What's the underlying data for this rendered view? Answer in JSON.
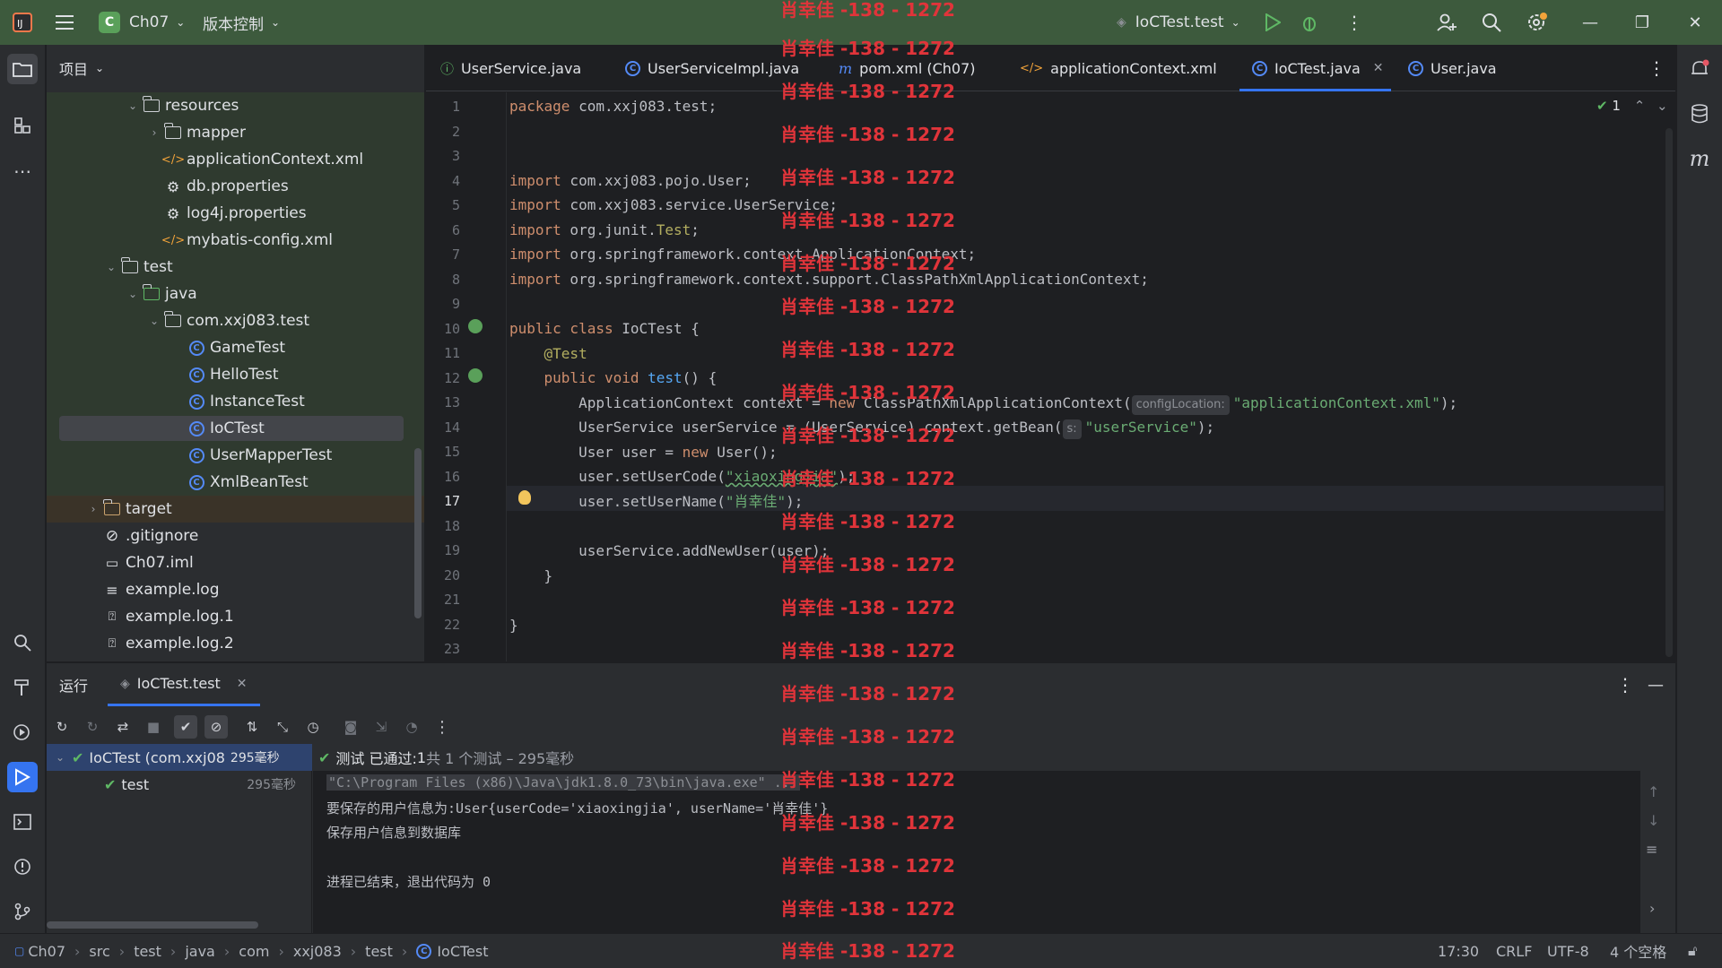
{
  "titlebar": {
    "project_badge": "C",
    "project_name": "Ch07",
    "vcs_label": "版本控制",
    "run_config": "IoCTest.test"
  },
  "project_panel": {
    "title": "项目",
    "items": [
      {
        "label": "resources"
      },
      {
        "label": "mapper"
      },
      {
        "label": "applicationContext.xml"
      },
      {
        "label": "db.properties"
      },
      {
        "label": "log4j.properties"
      },
      {
        "label": "mybatis-config.xml"
      },
      {
        "label": "test"
      },
      {
        "label": "java"
      },
      {
        "label": "com.xxj083.test"
      },
      {
        "label": "GameTest"
      },
      {
        "label": "HelloTest"
      },
      {
        "label": "InstanceTest"
      },
      {
        "label": "IoCTest"
      },
      {
        "label": "UserMapperTest"
      },
      {
        "label": "XmlBeanTest"
      },
      {
        "label": "target"
      },
      {
        "label": ".gitignore"
      },
      {
        "label": "Ch07.iml"
      },
      {
        "label": "example.log"
      },
      {
        "label": "example.log.1"
      },
      {
        "label": "example.log.2"
      }
    ]
  },
  "tabs": [
    {
      "label": "UserService.java"
    },
    {
      "label": "UserServiceImpl.java"
    },
    {
      "label": "pom.xml (Ch07)"
    },
    {
      "label": "applicationContext.xml"
    },
    {
      "label": "IoCTest.java"
    },
    {
      "label": "User.java"
    }
  ],
  "editor": {
    "inspection_count": "1",
    "line_numbers": [
      "1",
      "2",
      "3",
      "4",
      "5",
      "6",
      "7",
      "8",
      "9",
      "10",
      "11",
      "12",
      "13",
      "14",
      "15",
      "16",
      "17",
      "18",
      "19",
      "20",
      "21",
      "22",
      "23"
    ],
    "current_line": 17,
    "code": {
      "l1_kw": "package",
      "l1_rest": " com.xxj083.test;",
      "l4_kw": "import",
      "l4_rest": " com.xxj083.pojo.User;",
      "l5_kw": "import",
      "l5_rest": " com.xxj083.service.UserService;",
      "l6_kw": "import",
      "l6_a": " org.junit.",
      "l6_b": "Test",
      "l6_c": ";",
      "l7_kw": "import",
      "l7_rest": " org.springframework.context.ApplicationContext;",
      "l8_kw": "import",
      "l8_rest": " org.springframework.context.support.ClassPathXmlApplicationContext;",
      "l10_kw": "public class",
      "l10_rest": " IoCTest {",
      "l11_ann": "@Test",
      "l12_kw": "public void",
      "l12_fn": "test",
      "l12_rest": "() {",
      "l13_a": "ApplicationContext context = ",
      "l13_kw": "new",
      "l13_b": " ClassPathXmlApplicationContext(",
      "l13_hint": "configLocation:",
      "l13_str": "\"applicationContext.xml\"",
      "l13_c": ");",
      "l14_a": "UserService userService = (UserService) context.getBean(",
      "l14_hint": "s:",
      "l14_str": "\"userService\"",
      "l14_c": ");",
      "l15_a": "User user = ",
      "l15_kw": "new",
      "l15_b": " User();",
      "l16_a": "user.setUserCode(",
      "l16_str": "\"xiaoxingjia\"",
      "l16_c": ");",
      "l17_a": "user.setUserName(",
      "l17_str": "\"肖幸佳\"",
      "l17_c": ");",
      "l19_a": "userService.addNewUser(user);",
      "l20": "}",
      "l22": "}"
    }
  },
  "watermark": "肖幸佳 -138 - 1272",
  "run_panel": {
    "title": "运行",
    "tab_label": "IoCTest.test",
    "tree": [
      {
        "label": "IoCTest (com.xxj08",
        "time": "295毫秒"
      },
      {
        "label": "test",
        "time": "295毫秒"
      }
    ],
    "status_prefix": "测试 已通过: ",
    "status_count": "1",
    "status_suffix": "共 1 个测试 – 295毫秒",
    "console": [
      "\"C:\\Program Files (x86)\\Java\\jdk1.8.0_73\\bin\\java.exe\" ...",
      "要保存的用户信息为:User{userCode='xiaoxingjia', userName='肖幸佳'}",
      "保存用户信息到数据库",
      "进程已结束，退出代码为 0"
    ]
  },
  "statusbar": {
    "breadcrumbs": [
      "Ch07",
      "src",
      "test",
      "java",
      "com",
      "xxj083",
      "test",
      "IoCTest"
    ],
    "position": "17:30",
    "line_sep": "CRLF",
    "encoding": "UTF-8",
    "indent": "4 个空格"
  },
  "colors": {
    "titlebar_bg": "#3d5a3d",
    "accent": "#3574f0",
    "keyword": "#cf8e6d",
    "string": "#6aab73",
    "watermark": "#e0343a"
  }
}
